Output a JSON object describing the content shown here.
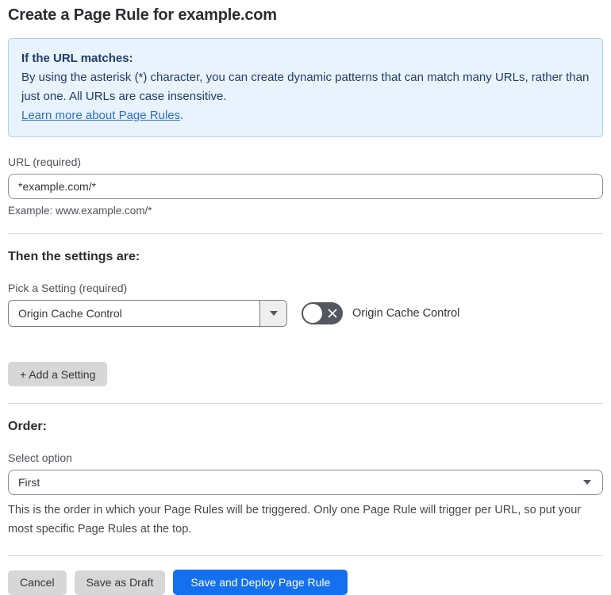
{
  "page": {
    "title": "Create a Page Rule for example.com"
  },
  "info_box": {
    "heading": "If the URL matches:",
    "body": "By using the asterisk (*) character, you can create dynamic patterns that can match many URLs, rather than just one. All URLs are case insensitive.",
    "link_text": "Learn more about Page Rules",
    "link_suffix": "."
  },
  "url_section": {
    "label": "URL (required)",
    "value": "*example.com/*",
    "helper": "Example: www.example.com/*"
  },
  "settings_section": {
    "heading": "Then the settings are:",
    "picker_label": "Pick a Setting (required)",
    "picker_value": "Origin Cache Control",
    "toggle_label": "Origin Cache Control",
    "toggle_state": "off",
    "add_setting_label": "+ Add a Setting"
  },
  "order_section": {
    "heading": "Order:",
    "select_label": "Select option",
    "select_value": "First",
    "helper": "This is the order in which your Page Rules will be triggered. Only one Page Rule will trigger per URL, so put your most specific Page Rules at the top."
  },
  "actions": {
    "cancel_label": "Cancel",
    "save_draft_label": "Save as Draft",
    "save_deploy_label": "Save and Deploy Page Rule"
  },
  "colors": {
    "info_bg": "#e9f3fd",
    "info_border": "#a9d3f2",
    "info_text": "#1e3d70",
    "link_blue": "#2c6ecb",
    "primary_blue": "#1570ef",
    "button_gray": "#d7d7d7",
    "toggle_off_bg": "#54575e"
  }
}
